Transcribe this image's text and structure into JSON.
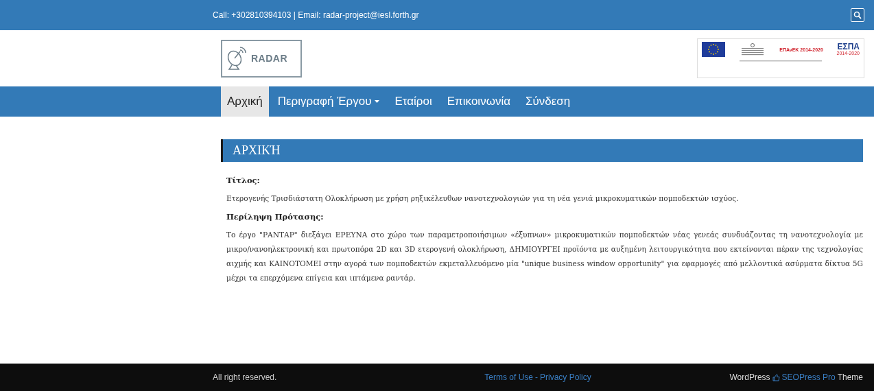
{
  "top_bar": {
    "contact": "Call: +302810394103 | Email: radar-project@iesl.forth.gr"
  },
  "header": {
    "logo_text": "RADAR",
    "banner": {
      "program": "ΕΠΑνΕΚ 2014-2020",
      "espa": "ΕΣΠΑ",
      "espa_years": "2014-2020"
    }
  },
  "nav": [
    {
      "label": "Αρχική",
      "selected": true,
      "dropdown": false
    },
    {
      "label": "Περιγραφή Έργου",
      "selected": false,
      "dropdown": true
    },
    {
      "label": "Εταίροι",
      "selected": false,
      "dropdown": false
    },
    {
      "label": "Επικοινωνία",
      "selected": false,
      "dropdown": false
    },
    {
      "label": "Σύνδεση",
      "selected": false,
      "dropdown": false
    }
  ],
  "page_title": "ΑΡΧΙΚΉ",
  "content": [
    {
      "kind": "heading",
      "text": "Τίτλος:"
    },
    {
      "kind": "paragraph",
      "text": "Ετερογενής Τρισδιάστατη Ολοκλήρωση με χρήση ρηξικέλευθων νανοτεχνολογιών για τη νέα γενιά μικροκυματικών πομποδεκτών ισχύος."
    },
    {
      "kind": "heading",
      "text": "Περίληψη Πρότασης:"
    },
    {
      "kind": "paragraph",
      "text": "Το έργο \"ΡΑΝΤΑΡ\" διεξάγει ΕΡΕΥΝΑ στο χώρο των παραμετροποιήσιμων «έξυπνων» μικροκυματικών πομποδεκτών νέας γενεάς συνδυάζοντας τη νανοτεχνολογία με μικρο/νανοηλεκτρονική και πρωτοπόρα 2D και 3D ετερογενή ολοκλήρωση, ΔΗΜΙΟΥΡΓΕΙ προϊόντα με αυξημένη λειτουργικότητα που εκτείνονται πέραν της τεχνολογίας αιχμής και ΚΑΙΝΟΤΟΜΕΙ στην αγορά των πομποδεκτών εκμεταλλευόμενο μία \"unique business window opportunity\" για εφαρμογές από μελλοντικά ασύρματα δίκτυα 5G μέχρι τα επερχόμενα επίγεια και ιπτάμενα ραντάρ."
    }
  ],
  "footer": {
    "copyright": "All right reserved.",
    "terms": "Terms of Use",
    "separator": "-",
    "privacy": "Privacy Policy",
    "credit_prefix": "WordPress",
    "credit_theme": "SEOPress Pro",
    "credit_suffix": "Theme"
  }
}
